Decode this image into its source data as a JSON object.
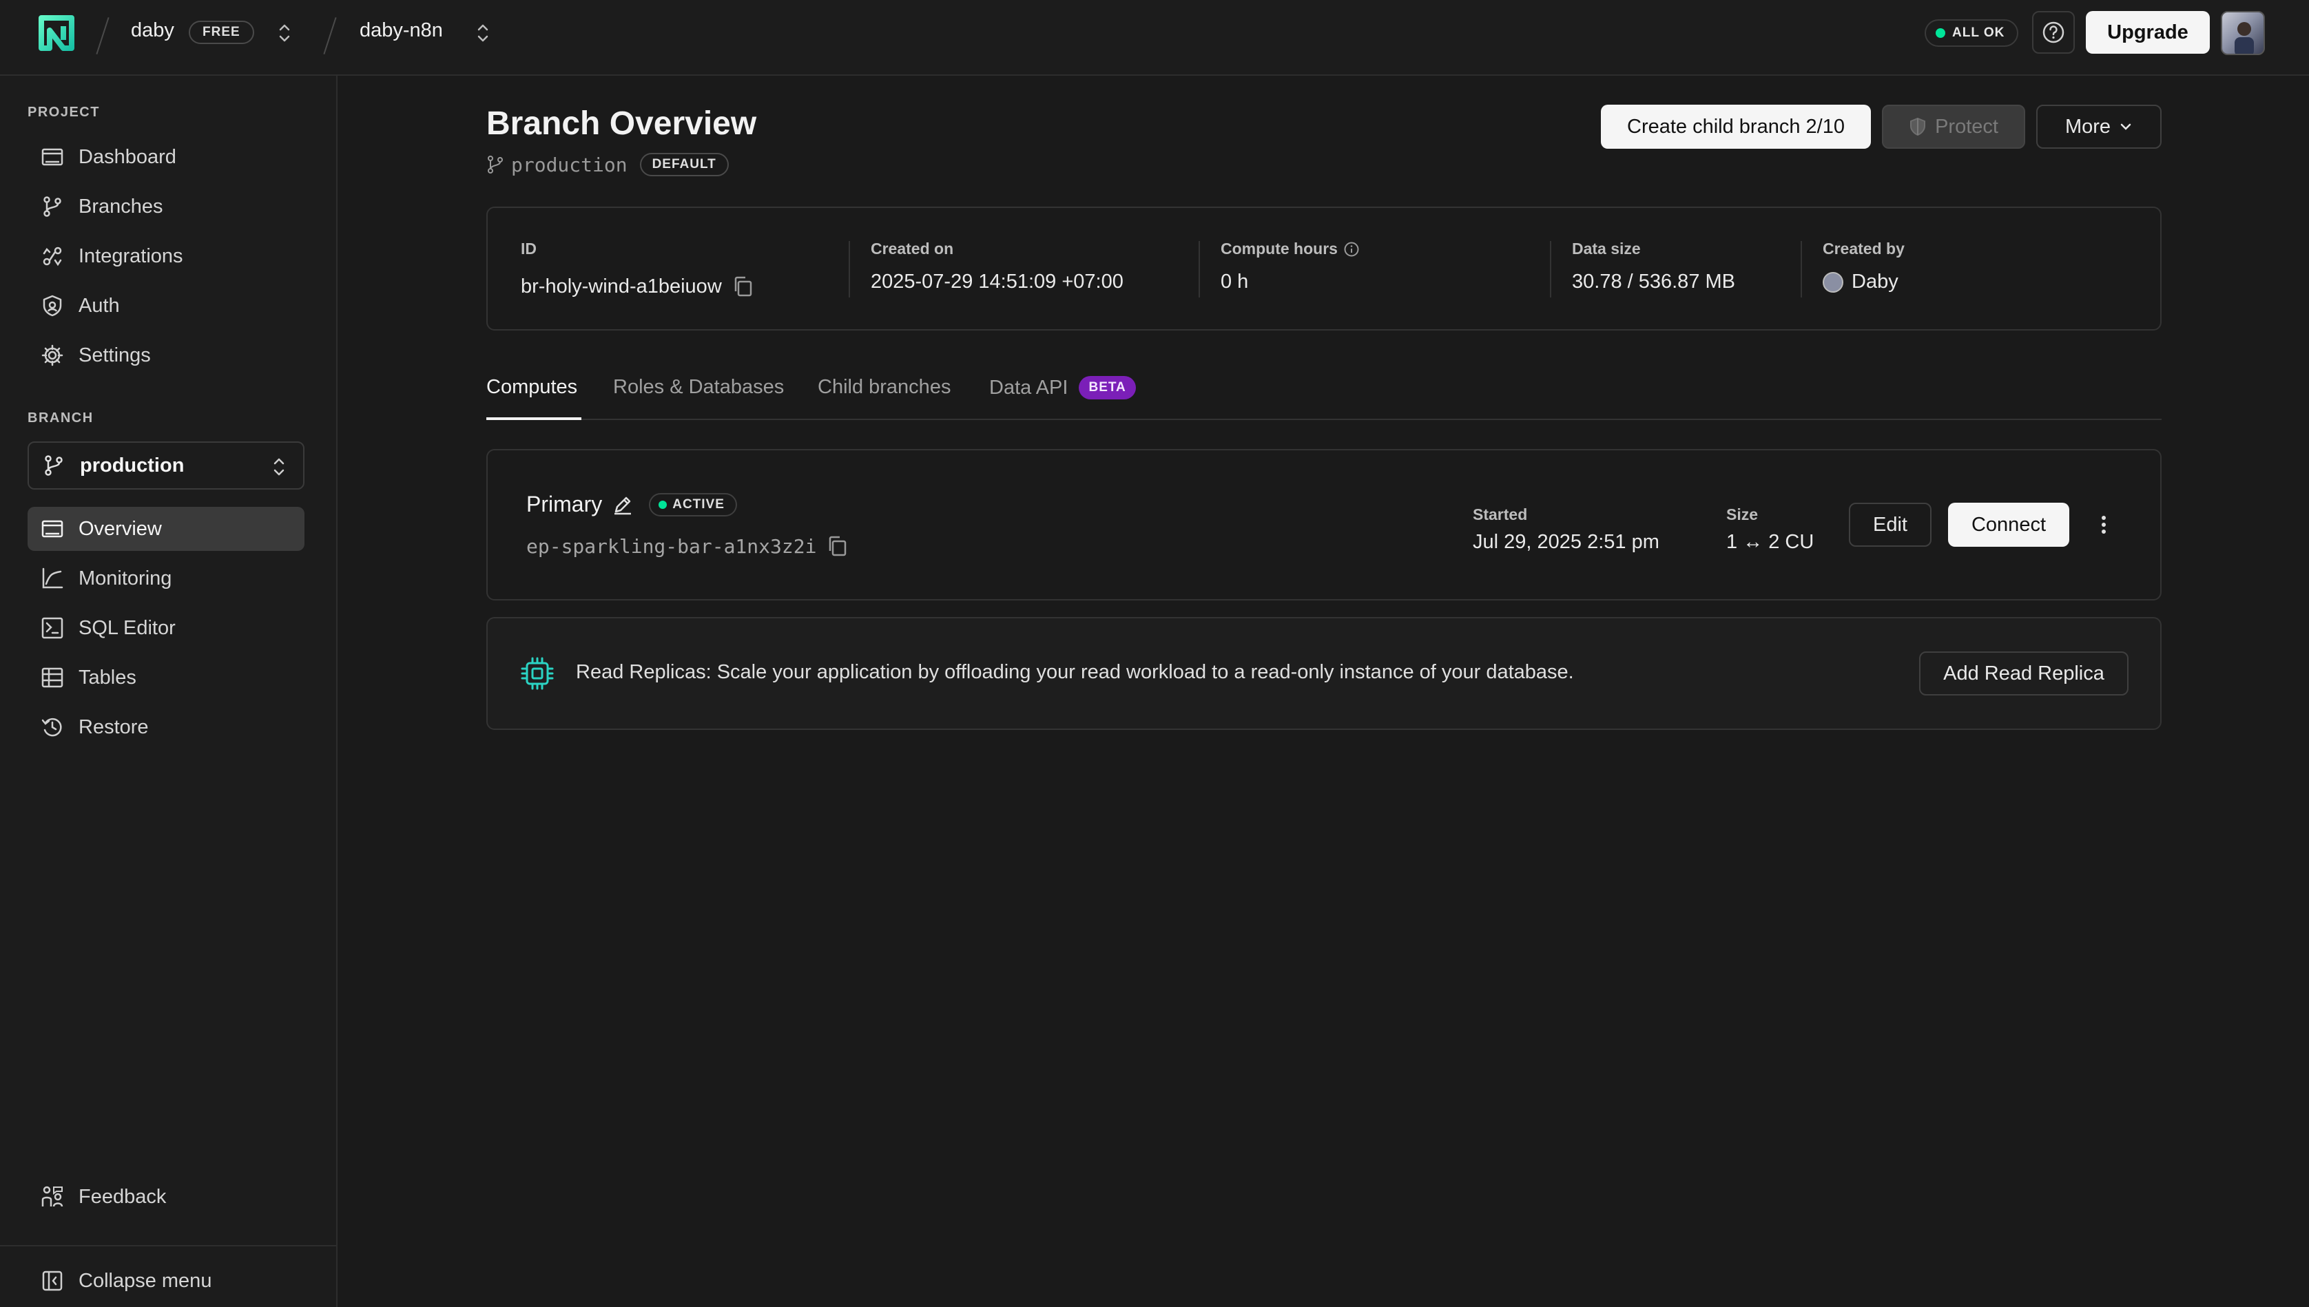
{
  "topbar": {
    "org_name": "daby",
    "plan_badge": "FREE",
    "project_name": "daby-n8n",
    "status": "ALL OK",
    "upgrade_label": "Upgrade",
    "status_color": "#00e599"
  },
  "sidebar": {
    "project_section": "PROJECT",
    "project_items": [
      {
        "label": "Dashboard",
        "icon": "dashboard-icon"
      },
      {
        "label": "Branches",
        "icon": "branches-icon"
      },
      {
        "label": "Integrations",
        "icon": "integrations-icon"
      },
      {
        "label": "Auth",
        "icon": "auth-icon"
      },
      {
        "label": "Settings",
        "icon": "settings-icon"
      }
    ],
    "branch_section": "BRANCH",
    "branch_selected": "production",
    "branch_items": [
      {
        "label": "Overview",
        "icon": "overview-icon",
        "active": true
      },
      {
        "label": "Monitoring",
        "icon": "monitoring-icon"
      },
      {
        "label": "SQL Editor",
        "icon": "sql-editor-icon"
      },
      {
        "label": "Tables",
        "icon": "tables-icon"
      },
      {
        "label": "Restore",
        "icon": "restore-icon"
      }
    ],
    "feedback_label": "Feedback",
    "collapse_label": "Collapse menu"
  },
  "header": {
    "title": "Branch Overview",
    "branch_name": "production",
    "default_badge": "DEFAULT",
    "create_child_label": "Create child branch 2/10",
    "protect_label": "Protect",
    "more_label": "More"
  },
  "info": {
    "id_label": "ID",
    "id_value": "br-holy-wind-a1beiuow",
    "created_on_label": "Created on",
    "created_on_value": "2025-07-29 14:51:09 +07:00",
    "compute_hours_label": "Compute hours",
    "compute_hours_value": "0 h",
    "data_size_label": "Data size",
    "data_size_value": "30.78 / 536.87 MB",
    "created_by_label": "Created by",
    "created_by_value": "Daby"
  },
  "tabs": [
    {
      "label": "Computes",
      "active": true
    },
    {
      "label": "Roles & Databases"
    },
    {
      "label": "Child branches"
    },
    {
      "label": "Data API",
      "badge": "BETA"
    }
  ],
  "compute": {
    "name": "Primary",
    "status": "ACTIVE",
    "endpoint": "ep-sparkling-bar-a1nx3z2i",
    "started_label": "Started",
    "started_value": "Jul 29, 2025 2:51 pm",
    "size_label": "Size",
    "size_value": "1 ↔ 2 CU",
    "edit_label": "Edit",
    "connect_label": "Connect"
  },
  "replica": {
    "text": "Read Replicas: Scale your application by offloading your read workload to a read-only instance of your database.",
    "button_label": "Add Read Replica",
    "accent": "#2bd3c3"
  },
  "beta_color": "#7b1fb8"
}
